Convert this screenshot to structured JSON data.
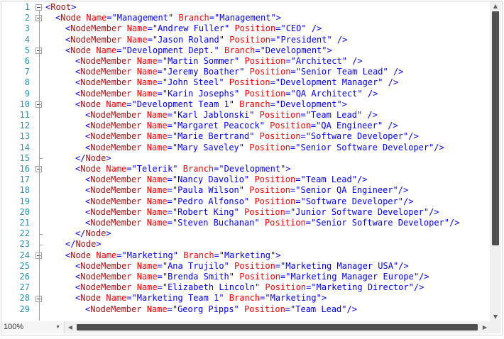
{
  "editor": {
    "lines": [
      {
        "n": "1",
        "indent": 0,
        "fold": "open",
        "tokens": [
          [
            "<",
            "b"
          ],
          [
            "Root",
            "t"
          ],
          [
            ">",
            "b"
          ]
        ]
      },
      {
        "n": "2",
        "indent": 1,
        "fold": "open",
        "tokens": [
          [
            "<",
            "b"
          ],
          [
            "Node",
            "t"
          ],
          [
            " ",
            "b"
          ],
          [
            "Name",
            "a"
          ],
          [
            "=\"Management\" ",
            "b"
          ],
          [
            "Branch",
            "a"
          ],
          [
            "=\"Management\">",
            "b"
          ]
        ]
      },
      {
        "n": "3",
        "indent": 2,
        "fold": "none",
        "tokens": [
          [
            "<",
            "b"
          ],
          [
            "NodeMember",
            "t"
          ],
          [
            " ",
            "b"
          ],
          [
            "Name",
            "a"
          ],
          [
            "=\"Andrew Fuller\" ",
            "b"
          ],
          [
            "Position",
            "a"
          ],
          [
            "=\"CEO\" />",
            "b"
          ]
        ]
      },
      {
        "n": "4",
        "indent": 2,
        "fold": "none",
        "tokens": [
          [
            "<",
            "b"
          ],
          [
            "NodeMember",
            "t"
          ],
          [
            " ",
            "b"
          ],
          [
            "Name",
            "a"
          ],
          [
            "=\"Jason Roland\" ",
            "b"
          ],
          [
            "Position",
            "a"
          ],
          [
            "=\"President\" />",
            "b"
          ]
        ]
      },
      {
        "n": "5",
        "indent": 2,
        "fold": "open",
        "tokens": [
          [
            "<",
            "b"
          ],
          [
            "Node",
            "t"
          ],
          [
            " ",
            "b"
          ],
          [
            "Name",
            "a"
          ],
          [
            "=\"Development Dept.\" ",
            "b"
          ],
          [
            "Branch",
            "a"
          ],
          [
            "=\"Development\">",
            "b"
          ]
        ]
      },
      {
        "n": "6",
        "indent": 3,
        "fold": "none",
        "tokens": [
          [
            "<",
            "b"
          ],
          [
            "NodeMember",
            "t"
          ],
          [
            " ",
            "b"
          ],
          [
            "Name",
            "a"
          ],
          [
            "=\"Martin Sommer\" ",
            "b"
          ],
          [
            "Position",
            "a"
          ],
          [
            "=\"Architect\" />",
            "b"
          ]
        ]
      },
      {
        "n": "7",
        "indent": 3,
        "fold": "none",
        "tokens": [
          [
            "<",
            "b"
          ],
          [
            "NodeMember",
            "t"
          ],
          [
            " ",
            "b"
          ],
          [
            "Name",
            "a"
          ],
          [
            "=\"Jeremy Boather\" ",
            "b"
          ],
          [
            "Position",
            "a"
          ],
          [
            "=\"Senior Team Lead\" />",
            "b"
          ]
        ]
      },
      {
        "n": "8",
        "indent": 3,
        "fold": "none",
        "tokens": [
          [
            "<",
            "b"
          ],
          [
            "NodeMember",
            "t"
          ],
          [
            " ",
            "b"
          ],
          [
            "Name",
            "a"
          ],
          [
            "=\"John Steel\" ",
            "b"
          ],
          [
            "Position",
            "a"
          ],
          [
            "=\"Development Manager\" />",
            "b"
          ]
        ]
      },
      {
        "n": "9",
        "indent": 3,
        "fold": "none",
        "tokens": [
          [
            "<",
            "b"
          ],
          [
            "NodeMember",
            "t"
          ],
          [
            " ",
            "b"
          ],
          [
            "Name",
            "a"
          ],
          [
            "=\"Karin Josephs\" ",
            "b"
          ],
          [
            "Position",
            "a"
          ],
          [
            "=\"QA Architect\" />",
            "b"
          ]
        ]
      },
      {
        "n": "10",
        "indent": 3,
        "fold": "open",
        "tokens": [
          [
            "<",
            "b"
          ],
          [
            "Node",
            "t"
          ],
          [
            " ",
            "b"
          ],
          [
            "Name",
            "a"
          ],
          [
            "=\"Development Team 1\" ",
            "b"
          ],
          [
            "Branch",
            "a"
          ],
          [
            "=\"Development\">",
            "b"
          ]
        ]
      },
      {
        "n": "11",
        "indent": 4,
        "fold": "none",
        "tokens": [
          [
            "<",
            "b"
          ],
          [
            "NodeMember",
            "t"
          ],
          [
            " ",
            "b"
          ],
          [
            "Name",
            "a"
          ],
          [
            "=\"Karl Jablonski\" ",
            "b"
          ],
          [
            "Position",
            "a"
          ],
          [
            "=\"Team Lead\" />",
            "b"
          ]
        ]
      },
      {
        "n": "12",
        "indent": 4,
        "fold": "none",
        "tokens": [
          [
            "<",
            "b"
          ],
          [
            "NodeMember",
            "t"
          ],
          [
            " ",
            "b"
          ],
          [
            "Name",
            "a"
          ],
          [
            "=\"Margaret Peacock\" ",
            "b"
          ],
          [
            "Position",
            "a"
          ],
          [
            "=\"QA Engineer\" />",
            "b"
          ]
        ]
      },
      {
        "n": "13",
        "indent": 4,
        "fold": "none",
        "tokens": [
          [
            "<",
            "b"
          ],
          [
            "NodeMember",
            "t"
          ],
          [
            " ",
            "b"
          ],
          [
            "Name",
            "a"
          ],
          [
            "=\"Marie Bertrand\" ",
            "b"
          ],
          [
            "Position",
            "a"
          ],
          [
            "=\"Software Developer\"/>",
            "b"
          ]
        ]
      },
      {
        "n": "14",
        "indent": 4,
        "fold": "none",
        "tokens": [
          [
            "<",
            "b"
          ],
          [
            "NodeMember",
            "t"
          ],
          [
            " ",
            "b"
          ],
          [
            "Name",
            "a"
          ],
          [
            "=\"Mary Saveley\" ",
            "b"
          ],
          [
            "Position",
            "a"
          ],
          [
            "=\"Senior Software Developer\"/>",
            "b"
          ]
        ]
      },
      {
        "n": "15",
        "indent": 3,
        "fold": "end",
        "tokens": [
          [
            "</",
            "b"
          ],
          [
            "Node",
            "t"
          ],
          [
            ">",
            "b"
          ]
        ]
      },
      {
        "n": "16",
        "indent": 3,
        "fold": "open",
        "tokens": [
          [
            "<",
            "b"
          ],
          [
            "Node",
            "t"
          ],
          [
            " ",
            "b"
          ],
          [
            "Name",
            "a"
          ],
          [
            "=\"Telerik\" ",
            "b"
          ],
          [
            "Branch",
            "a"
          ],
          [
            "=\"Development\">",
            "b"
          ]
        ]
      },
      {
        "n": "17",
        "indent": 4,
        "fold": "none",
        "tokens": [
          [
            "<",
            "b"
          ],
          [
            "NodeMember",
            "t"
          ],
          [
            " ",
            "b"
          ],
          [
            "Name",
            "a"
          ],
          [
            "=\"Nancy Davolio\" ",
            "b"
          ],
          [
            "Position",
            "a"
          ],
          [
            "=\"Team Lead\"/>",
            "b"
          ]
        ]
      },
      {
        "n": "18",
        "indent": 4,
        "fold": "none",
        "tokens": [
          [
            "<",
            "b"
          ],
          [
            "NodeMember",
            "t"
          ],
          [
            " ",
            "b"
          ],
          [
            "Name",
            "a"
          ],
          [
            "=\"Paula Wilson\" ",
            "b"
          ],
          [
            "Position",
            "a"
          ],
          [
            "=\"Senior QA Engineer\"/>",
            "b"
          ]
        ]
      },
      {
        "n": "19",
        "indent": 4,
        "fold": "none",
        "tokens": [
          [
            "<",
            "b"
          ],
          [
            "NodeMember",
            "t"
          ],
          [
            " ",
            "b"
          ],
          [
            "Name",
            "a"
          ],
          [
            "=\"Pedro Alfonso\" ",
            "b"
          ],
          [
            "Position",
            "a"
          ],
          [
            "=\"Software Developer\"/>",
            "b"
          ]
        ]
      },
      {
        "n": "20",
        "indent": 4,
        "fold": "none",
        "tokens": [
          [
            "<",
            "b"
          ],
          [
            "NodeMember",
            "t"
          ],
          [
            " ",
            "b"
          ],
          [
            "Name",
            "a"
          ],
          [
            "=\"Robert King\" ",
            "b"
          ],
          [
            "Position",
            "a"
          ],
          [
            "=\"Junior Software Developer\"/>",
            "b"
          ]
        ]
      },
      {
        "n": "21",
        "indent": 4,
        "fold": "none",
        "tokens": [
          [
            "<",
            "b"
          ],
          [
            "NodeMember",
            "t"
          ],
          [
            " ",
            "b"
          ],
          [
            "Name",
            "a"
          ],
          [
            "=\"Steven Buchanan\" ",
            "b"
          ],
          [
            "Position",
            "a"
          ],
          [
            "=\"Senior Software Developer\"/>",
            "b"
          ]
        ]
      },
      {
        "n": "22",
        "indent": 3,
        "fold": "end",
        "tokens": [
          [
            "</",
            "b"
          ],
          [
            "Node",
            "t"
          ],
          [
            ">",
            "b"
          ]
        ]
      },
      {
        "n": "23",
        "indent": 2,
        "fold": "end",
        "tokens": [
          [
            "</",
            "b"
          ],
          [
            "Node",
            "t"
          ],
          [
            ">",
            "b"
          ]
        ]
      },
      {
        "n": "24",
        "indent": 2,
        "fold": "open",
        "tokens": [
          [
            "<",
            "b"
          ],
          [
            "Node",
            "t"
          ],
          [
            " ",
            "b"
          ],
          [
            "Name",
            "a"
          ],
          [
            "=\"Marketing\" ",
            "b"
          ],
          [
            "Branch",
            "a"
          ],
          [
            "=\"Marketing\">",
            "b"
          ]
        ]
      },
      {
        "n": "25",
        "indent": 3,
        "fold": "none",
        "tokens": [
          [
            "<",
            "b"
          ],
          [
            "NodeMember",
            "t"
          ],
          [
            " ",
            "b"
          ],
          [
            "Name",
            "a"
          ],
          [
            "=\"Ana Trujilo\" ",
            "b"
          ],
          [
            "Position",
            "a"
          ],
          [
            "=\"Marketing Manager USA\"/>",
            "b"
          ]
        ]
      },
      {
        "n": "26",
        "indent": 3,
        "fold": "none",
        "tokens": [
          [
            "<",
            "b"
          ],
          [
            "NodeMember",
            "t"
          ],
          [
            " ",
            "b"
          ],
          [
            "Name",
            "a"
          ],
          [
            "=\"Brenda Smith\" ",
            "b"
          ],
          [
            "Position",
            "a"
          ],
          [
            "=\"Marketing Manager Europe\"/>",
            "b"
          ]
        ]
      },
      {
        "n": "27",
        "indent": 3,
        "fold": "none",
        "tokens": [
          [
            "<",
            "b"
          ],
          [
            "NodeMember",
            "t"
          ],
          [
            " ",
            "b"
          ],
          [
            "Name",
            "a"
          ],
          [
            "=\"Elizabeth Lincoln\" ",
            "b"
          ],
          [
            "Position",
            "a"
          ],
          [
            "=\"Marketing Director\"/>",
            "b"
          ]
        ]
      },
      {
        "n": "28",
        "indent": 3,
        "fold": "open",
        "tokens": [
          [
            "<",
            "b"
          ],
          [
            "Node",
            "t"
          ],
          [
            " ",
            "b"
          ],
          [
            "Name",
            "a"
          ],
          [
            "=\"Marketing Team 1\" ",
            "b"
          ],
          [
            "Branch",
            "a"
          ],
          [
            "=\"Marketing\">",
            "b"
          ]
        ]
      },
      {
        "n": "29",
        "indent": 4,
        "fold": "none",
        "tokens": [
          [
            "<",
            "b"
          ],
          [
            "NodeMember",
            "t"
          ],
          [
            " ",
            "b"
          ],
          [
            "Name",
            "a"
          ],
          [
            "=\"Georg Pipps\" ",
            "b"
          ],
          [
            "Position",
            "a"
          ],
          [
            "=\"Team Lead\"/>",
            "b"
          ]
        ]
      }
    ]
  },
  "zoom": {
    "value": "100%"
  },
  "icons": {
    "fold_collapse": "minus-box-icon",
    "scroll_up": "arrow-up-icon",
    "scroll_down": "arrow-down-icon",
    "scroll_left": "arrow-left-icon",
    "scroll_right": "arrow-right-icon",
    "dropdown": "chevron-down-icon"
  },
  "colors": {
    "line_number": "#2b91af",
    "punctuation": "#0000ff",
    "tag": "#a31515",
    "attribute": "#ff0000",
    "scroll_thumb": "#4f4f4f"
  }
}
